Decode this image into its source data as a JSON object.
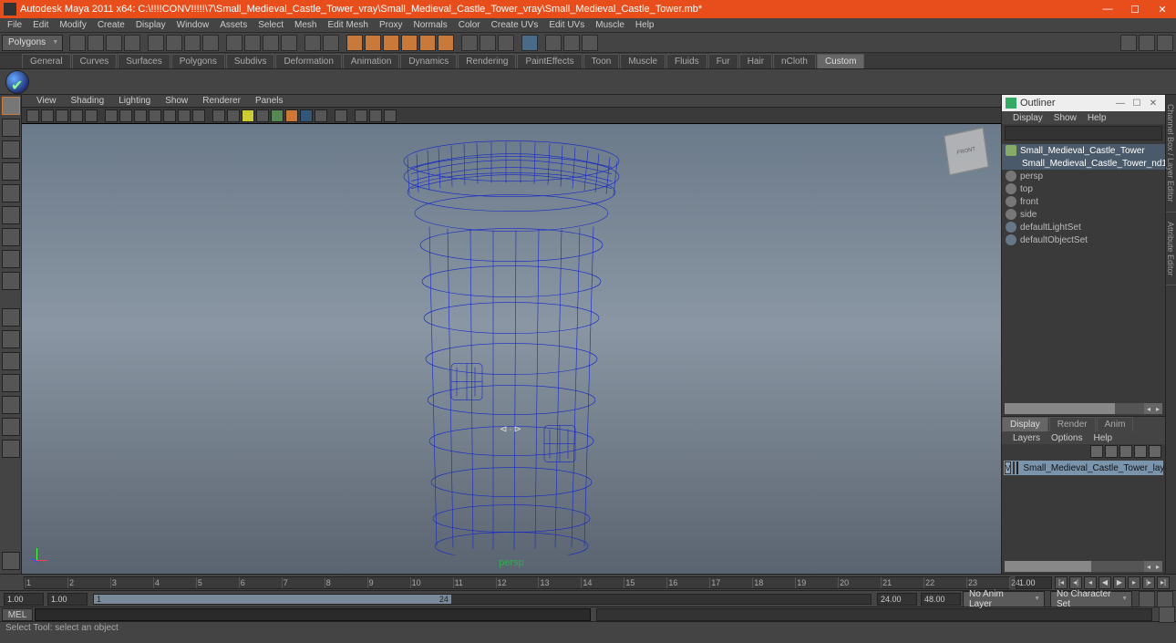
{
  "titlebar": {
    "app": "Autodesk Maya 2011 x64: C:\\!!!!CONV!!!!!\\7\\Small_Medieval_Castle_Tower_vray\\Small_Medieval_Castle_Tower_vray\\Small_Medieval_Castle_Tower.mb*",
    "min": "—",
    "max": "☐",
    "close": "✕"
  },
  "menus": [
    "File",
    "Edit",
    "Modify",
    "Create",
    "Display",
    "Window",
    "Assets",
    "Select",
    "Mesh",
    "Edit Mesh",
    "Proxy",
    "Normals",
    "Color",
    "Create UVs",
    "Edit UVs",
    "Muscle",
    "Help"
  ],
  "toolbar": {
    "mode": "Polygons"
  },
  "shelf_tabs": [
    "General",
    "Curves",
    "Surfaces",
    "Polygons",
    "Subdivs",
    "Deformation",
    "Animation",
    "Dynamics",
    "Rendering",
    "PaintEffects",
    "Toon",
    "Muscle",
    "Fluids",
    "Fur",
    "Hair",
    "nCloth",
    "Custom"
  ],
  "active_shelf": "Custom",
  "viewport_menus": [
    "View",
    "Shading",
    "Lighting",
    "Show",
    "Renderer",
    "Panels"
  ],
  "viewport": {
    "camera": "persp",
    "manip": "⊲·⊳"
  },
  "viewcube": "FRONT",
  "right_tabs": [
    "Channel Box / Layer Editor",
    "Attribute Editor"
  ],
  "outliner": {
    "title": "Outliner",
    "menus": [
      "Display",
      "Show",
      "Help"
    ],
    "items": [
      {
        "label": "Small_Medieval_Castle_Tower",
        "icon": "mesh",
        "sel": true,
        "indent": 0
      },
      {
        "label": "Small_Medieval_Castle_Tower_nd1...",
        "icon": "mesh",
        "sel": true,
        "indent": 1
      },
      {
        "label": "persp",
        "icon": "cam",
        "indent": 0
      },
      {
        "label": "top",
        "icon": "cam",
        "indent": 0
      },
      {
        "label": "front",
        "icon": "cam",
        "indent": 0
      },
      {
        "label": "side",
        "icon": "cam",
        "indent": 0
      },
      {
        "label": "defaultLightSet",
        "icon": "set",
        "indent": 0
      },
      {
        "label": "defaultObjectSet",
        "icon": "set",
        "indent": 0
      }
    ]
  },
  "layer_tabs": [
    "Display",
    "Render",
    "Anim"
  ],
  "active_layer_tab": "Display",
  "layer_menus": [
    "Layers",
    "Options",
    "Help"
  ],
  "layer": {
    "vis": "V",
    "name": "Small_Medieval_Castle_Tower_layer"
  },
  "timeline": {
    "ticks": [
      1,
      2,
      3,
      4,
      5,
      6,
      7,
      8,
      9,
      10,
      11,
      12,
      13,
      14,
      15,
      16,
      17,
      18,
      19,
      20,
      21,
      22,
      23,
      24
    ],
    "cur_start": "1.00",
    "cur_end": "1.00",
    "range_min": "1",
    "range_max": "24",
    "end_a": "24.00",
    "end_b": "48.00",
    "anim_layer": "No Anim Layer",
    "char_set": "No Character Set",
    "disp": "1.00"
  },
  "cmd": {
    "label": "MEL"
  },
  "helpline": "Select Tool: select an object"
}
